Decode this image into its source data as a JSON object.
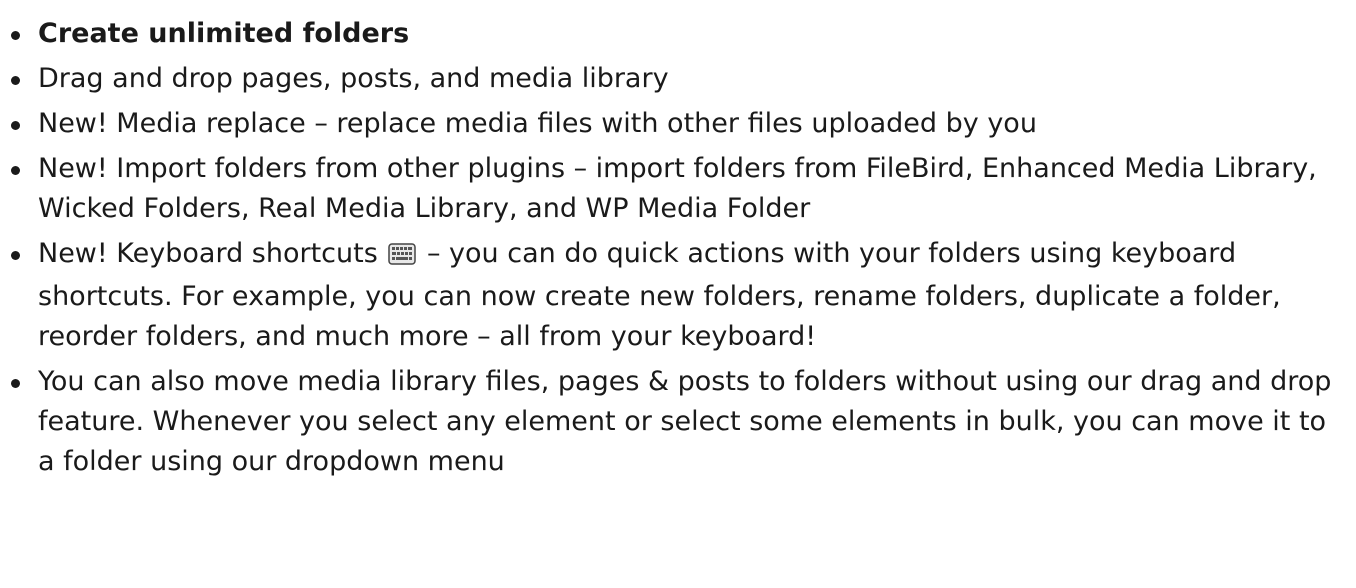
{
  "features": {
    "item1": "Create unlimited folders",
    "item2": "Drag and drop pages, posts, and media library",
    "item3": "New! Media replace – replace media files with other files uploaded by you",
    "item4": "New! Import folders from other plugins – import folders from FileBird, Enhanced Media Library, Wicked Folders, Real Media Library, and WP Media Folder",
    "item5_before_icon": "New! Keyboard shortcuts ",
    "item5_icon": "keyboard-icon",
    "item5_after_icon": " – you can do quick actions with your folders using keyboard shortcuts. For example, you can now create new folders, rename folders, duplicate a folder, reorder folders, and much more – all from your keyboard!",
    "item6": "You can also move media library files, pages & posts to folders without using our drag and drop feature. Whenever you select any element or select some elements in bulk, you can move it to a folder using our dropdown menu"
  }
}
